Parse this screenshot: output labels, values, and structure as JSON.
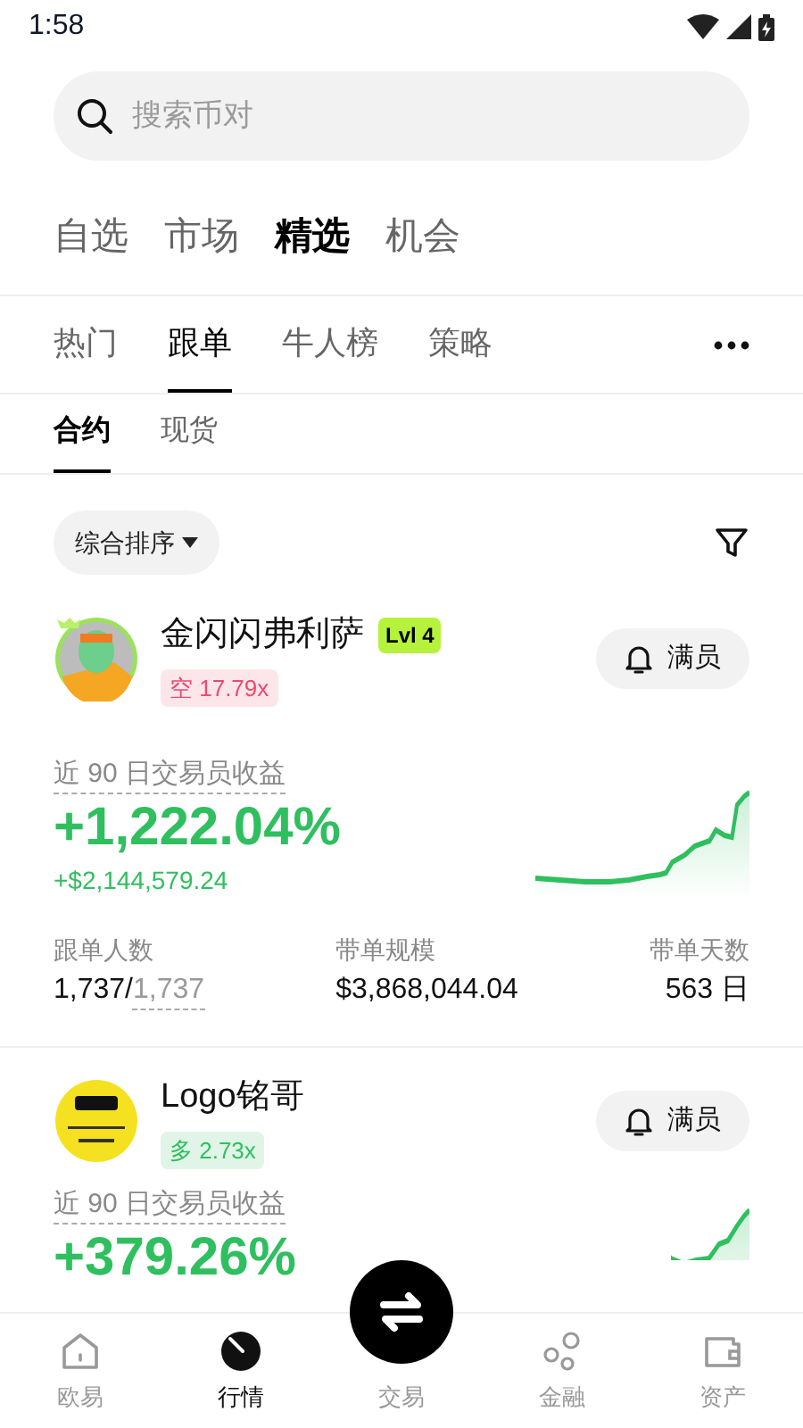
{
  "status_bar": {
    "time": "1:58"
  },
  "search": {
    "placeholder": "搜索币对"
  },
  "main_tabs": [
    {
      "label": "自选",
      "selected": false
    },
    {
      "label": "市场",
      "selected": false
    },
    {
      "label": "精选",
      "selected": true
    },
    {
      "label": "机会",
      "selected": false
    }
  ],
  "sub_tabs": [
    {
      "label": "热门",
      "selected": false
    },
    {
      "label": "跟单",
      "selected": true
    },
    {
      "label": "牛人榜",
      "selected": false
    },
    {
      "label": "策略",
      "selected": false
    }
  ],
  "market_tabs": [
    {
      "label": "合约",
      "selected": true
    },
    {
      "label": "现货",
      "selected": false
    }
  ],
  "sort": {
    "label": "综合排序"
  },
  "traders": [
    {
      "name": "金闪闪弗利萨",
      "level": "Lvl 4",
      "side": {
        "kind": "short",
        "text": "空 17.79x"
      },
      "button": "满员",
      "metric_label": "近 90 日交易员收益",
      "return": "+1,222.04%",
      "pnl": "+$2,144,579.24",
      "stats": [
        {
          "label": "跟单人数",
          "value": "1,737/",
          "limit": "1,737"
        },
        {
          "label": "带单规模",
          "value": "$3,868,044.04"
        },
        {
          "label": "带单天数",
          "value": "563 日"
        }
      ]
    },
    {
      "name": "Logo铭哥",
      "side": {
        "kind": "long",
        "text": "多 2.73x"
      },
      "button": "满员",
      "metric_label": "近 90 日交易员收益",
      "return": "+379.26%"
    }
  ],
  "nav": [
    {
      "kind": "home",
      "label": "欧易",
      "selected": false
    },
    {
      "kind": "market",
      "label": "行情",
      "selected": true
    },
    {
      "kind": "trade",
      "label": "交易",
      "selected": false
    },
    {
      "kind": "finance",
      "label": "金融",
      "selected": false
    },
    {
      "kind": "assets",
      "label": "资产",
      "selected": false
    }
  ]
}
